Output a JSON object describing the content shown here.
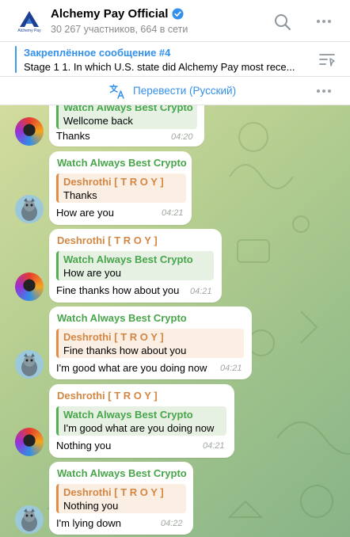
{
  "header": {
    "title": "Alchemy Pay Official",
    "subtitle": "30 267 участников, 664 в сети",
    "logo_caption": "Alchemy Pay"
  },
  "pinned": {
    "title": "Закреплённое сообщение #4",
    "text": "Stage 1   1. In which U.S. state did Alchemy Pay most rece..."
  },
  "translate": {
    "label": "Перевести (Русский)"
  },
  "messages": [
    {
      "sender": "",
      "reply_name": "Watch Always Best Crypto",
      "reply_text": "Wellcome back",
      "text": "Thanks",
      "time": "04:20"
    },
    {
      "sender": "Watch Always Best Crypto",
      "reply_name": "Deshrothi [ T R O Y ]",
      "reply_text": "Thanks",
      "text": "How are you",
      "time": "04:21"
    },
    {
      "sender": "Deshrothi [ T R O Y ]",
      "reply_name": "Watch Always Best Crypto",
      "reply_text": "How are you",
      "text": "Fine thanks how about you",
      "time": "04:21"
    },
    {
      "sender": "Watch Always Best Crypto",
      "reply_name": "Deshrothi [ T R O Y ]",
      "reply_text": "Fine thanks how about you",
      "text": "I'm good what are you doing now",
      "time": "04:21"
    },
    {
      "sender": "Deshrothi [ T R O Y ]",
      "reply_name": "Watch Always Best Crypto",
      "reply_text": "I'm good what are you doing now",
      "text": "Nothing you",
      "time": "04:21"
    },
    {
      "sender": "Watch Always Best Crypto",
      "reply_name": "Deshrothi [ T R O Y ]",
      "reply_text": "Nothing you",
      "text": "I'm lying down",
      "time": "04:22"
    }
  ],
  "colors": {
    "accent": "#3390ec",
    "green_name": "#48a54a",
    "orange_name": "#d38744"
  },
  "icons": {
    "search": "search-icon",
    "more": "more-icon",
    "pinned_list": "pinned-list-icon",
    "translate": "translate-icon",
    "verified": "verified-badge-icon"
  }
}
